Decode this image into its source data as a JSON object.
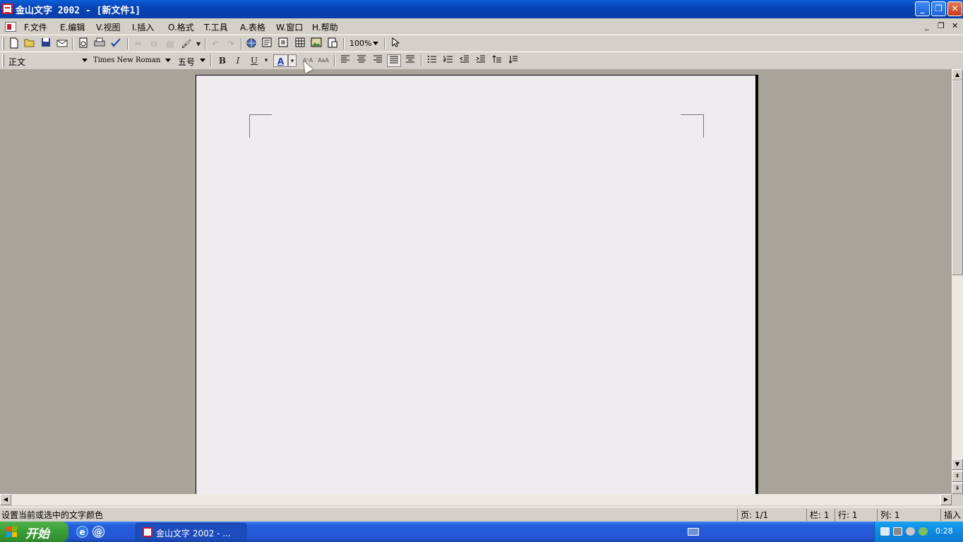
{
  "window": {
    "title": "金山文字 2002 - [新文件1]",
    "minimize_glyph": "_",
    "restore_glyph": "❐",
    "close_glyph": "✕"
  },
  "menu": {
    "items": [
      "F.文件",
      "E.编辑",
      "V.视图",
      "I.插入",
      "O.格式",
      "T.工具",
      "A.表格",
      "W.窗口",
      "H.帮助"
    ],
    "mdi_minimize": "_",
    "mdi_restore": "❐",
    "mdi_close": "✕"
  },
  "toolbar1": {
    "icons": [
      "new-document-icon",
      "open-folder-icon",
      "save-icon",
      "send-icon",
      "print-preview-icon",
      "print-icon",
      "spellcheck-icon",
      "cut-icon",
      "copy-icon",
      "paste-icon",
      "format-painter-icon",
      "undo-icon",
      "redo-icon",
      "hyperlink-icon",
      "textbox-icon",
      "frame-icon",
      "table-icon",
      "picture-icon",
      "object-icon",
      "select-arrow-icon"
    ],
    "zoom": "100%"
  },
  "toolbar2": {
    "style": "正文",
    "font": "Times New Roman",
    "size": "五号",
    "bold": "B",
    "italic": "I",
    "underline": "U",
    "font_color": "A",
    "superscript": "AᴬA",
    "subscript": "AᴀA",
    "active_button": "font-color"
  },
  "status": {
    "message": "设置当前或选中的文字颜色",
    "page": "页: 1/1",
    "column_section": "栏: 1",
    "line": "行: 1",
    "col": "列: 1",
    "mode": "插入"
  },
  "taskbar": {
    "start": "开始",
    "task_label": "金山文字 2002 - ...",
    "clock": "0:28",
    "tray_icons": [
      "network-icon",
      "vmware-icon",
      "volume-icon",
      "security-icon"
    ]
  },
  "colors": {
    "titlebar": "#0a4fc8",
    "workspace": "#a8a49a",
    "page": "#efecf0",
    "taskbar": "#245ddb",
    "start": "#3a9e36",
    "font_color_underline": "#1f3fb0"
  }
}
